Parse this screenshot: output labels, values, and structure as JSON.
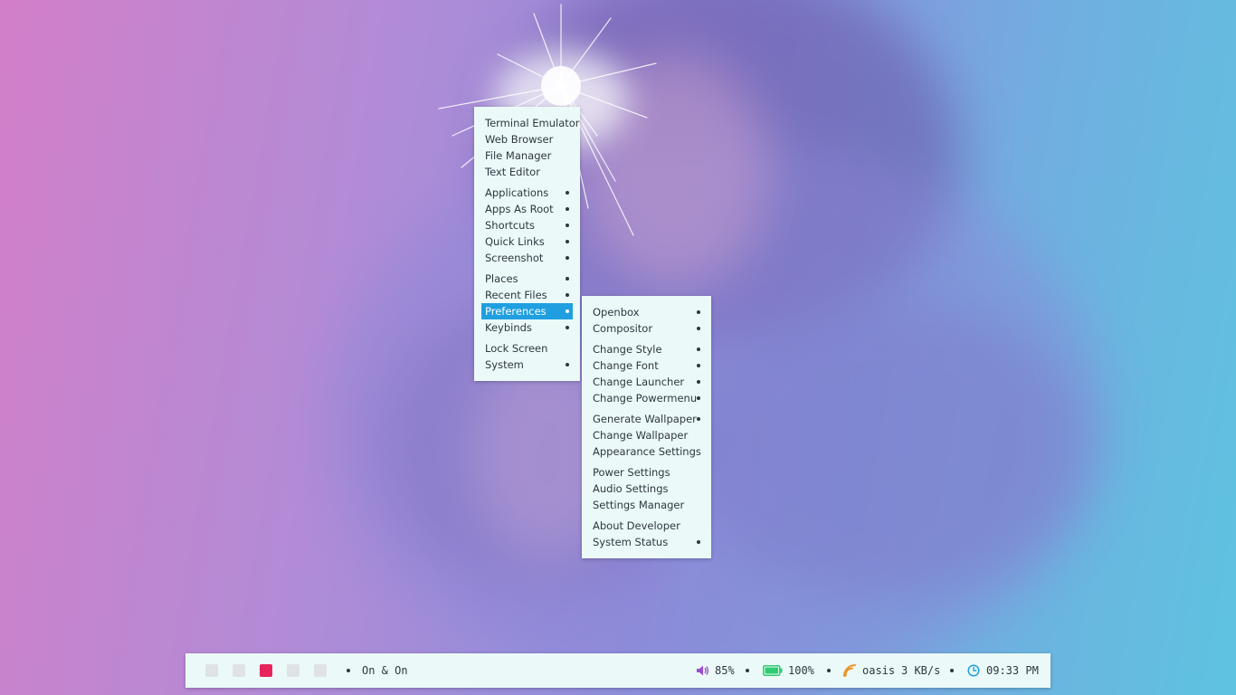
{
  "main_menu": {
    "items": [
      {
        "label": "Terminal Emulator",
        "submenu": false
      },
      {
        "label": "Web Browser",
        "submenu": false
      },
      {
        "label": "File Manager",
        "submenu": false
      },
      {
        "label": "Text Editor",
        "submenu": false
      },
      {
        "label": "Applications",
        "submenu": true
      },
      {
        "label": "Apps As Root",
        "submenu": true
      },
      {
        "label": "Shortcuts",
        "submenu": true
      },
      {
        "label": "Quick Links",
        "submenu": true
      },
      {
        "label": "Screenshot",
        "submenu": true
      },
      {
        "label": "Places",
        "submenu": true
      },
      {
        "label": "Recent Files",
        "submenu": true
      },
      {
        "label": "Preferences",
        "submenu": true,
        "active": true
      },
      {
        "label": "Keybinds",
        "submenu": true
      },
      {
        "label": "Lock Screen",
        "submenu": false
      },
      {
        "label": "System",
        "submenu": true
      }
    ]
  },
  "sub_menu": {
    "items": [
      {
        "label": "Openbox",
        "submenu": true
      },
      {
        "label": "Compositor",
        "submenu": true
      },
      {
        "label": "Change Style",
        "submenu": true
      },
      {
        "label": "Change Font",
        "submenu": true
      },
      {
        "label": "Change Launcher",
        "submenu": true
      },
      {
        "label": "Change Powermenu",
        "submenu": true
      },
      {
        "label": "Generate Wallpaper",
        "submenu": true
      },
      {
        "label": "Change Wallpaper",
        "submenu": false
      },
      {
        "label": "Appearance Settings",
        "submenu": false
      },
      {
        "label": "Power Settings",
        "submenu": false
      },
      {
        "label": "Audio Settings",
        "submenu": false
      },
      {
        "label": "Settings Manager",
        "submenu": false
      },
      {
        "label": "About Developer",
        "submenu": false
      },
      {
        "label": "System Status",
        "submenu": true
      }
    ]
  },
  "panel": {
    "workspaces": [
      {
        "active": false
      },
      {
        "active": false
      },
      {
        "active": true
      },
      {
        "active": false
      },
      {
        "active": false
      }
    ],
    "window_title": "On & On",
    "volume": {
      "icon": "speaker-icon",
      "text": "85%",
      "value": 85
    },
    "battery": {
      "icon": "battery-icon",
      "text": "100%",
      "value": 100
    },
    "network": {
      "icon": "wifi-icon",
      "ssid": "oasis",
      "speed": "3 KB/s"
    },
    "clock": {
      "icon": "clock-icon",
      "time": "09:33 PM"
    }
  },
  "colors": {
    "menu_bg": "#ebfaf8",
    "menu_text": "#2f3640",
    "highlight": "#1f9fe0",
    "active_workspace": "#e8245c",
    "volume": "#9b4dca",
    "battery": "#2ecc71",
    "wifi": "#f0932b",
    "clock": "#1f9fe0"
  }
}
